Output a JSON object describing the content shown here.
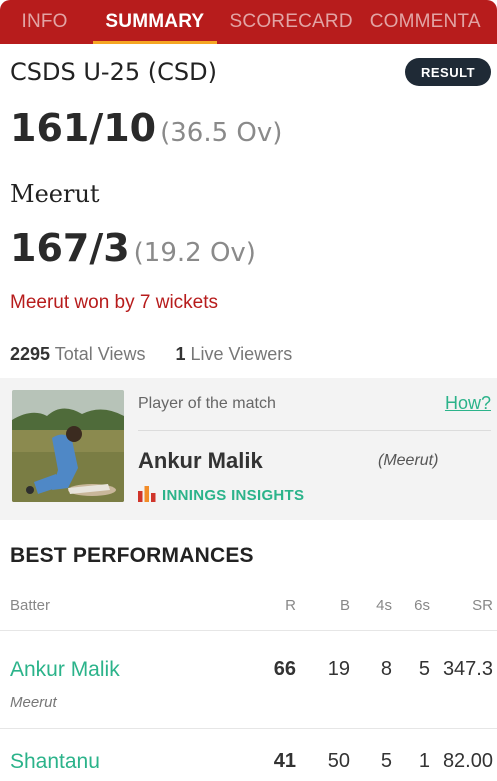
{
  "tabs": [
    {
      "label": "INFO",
      "active": false
    },
    {
      "label": "SUMMARY",
      "active": true
    },
    {
      "label": "SCORECARD",
      "active": false
    },
    {
      "label": "COMMENTA",
      "active": false
    }
  ],
  "colors": {
    "tab_bar": "#b71c1c",
    "accent_underline": "#f5a623",
    "result_badge": "#1f2a36",
    "result_text": "#b71c1c",
    "link_green": "#2bb38a"
  },
  "innings": [
    {
      "team": "CSDS U-25 (CSD)",
      "runs": "161/10",
      "overs": "(36.5 Ov)"
    },
    {
      "team": "Meerut",
      "runs": "167/3",
      "overs": "(19.2 Ov)"
    }
  ],
  "badge": "RESULT",
  "result_text": "Meerut won by 7 wickets",
  "views": {
    "total_count": "2295",
    "total_label": "Total Views",
    "live_count": "1",
    "live_label": "Live Viewers"
  },
  "potm": {
    "label": "Player of the match",
    "how_link": "How?",
    "name": "Ankur Malik",
    "team": "(Meerut)",
    "insights_label": "INNINGS INSIGHTS",
    "insights_icon": "bar-chart-icon"
  },
  "best_performances": {
    "title": "BEST PERFORMANCES",
    "headers": {
      "name": "Batter",
      "r": "R",
      "b": "B",
      "fours": "4s",
      "sixes": "6s",
      "sr": "SR"
    },
    "rows": [
      {
        "name": "Ankur Malik",
        "team": "Meerut",
        "r": "66",
        "b": "19",
        "fours": "8",
        "sixes": "5",
        "sr": "347.3"
      },
      {
        "name": "Shantanu",
        "team": "",
        "r": "41",
        "b": "50",
        "fours": "5",
        "sixes": "1",
        "sr": "82.00"
      }
    ]
  }
}
